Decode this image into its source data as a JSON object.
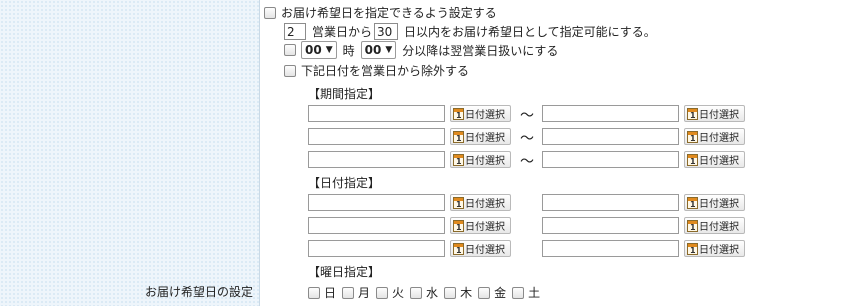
{
  "label": "お届け希望日の設定",
  "enable": {
    "label": "お届け希望日を指定できるよう設定する"
  },
  "range": {
    "from": "2",
    "to": "30",
    "text1": "営業日から",
    "text2": "日以内をお届け希望日として指定可能にする。"
  },
  "cutoff": {
    "hour": "00",
    "hour_unit": "時",
    "minute": "00",
    "suffix": "分以降は翌営業日扱いにする"
  },
  "exclude": {
    "label": "下記日付を営業日から除外する"
  },
  "period": {
    "title": "【期間指定】",
    "tilde": "～"
  },
  "dates": {
    "title": "【日付指定】"
  },
  "weekday": {
    "title": "【曜日指定】",
    "days": [
      "日",
      "月",
      "火",
      "水",
      "木",
      "金",
      "土"
    ]
  },
  "date_button": {
    "label": "日付選択",
    "icon_digit": "1"
  },
  "icons": {
    "calendar": "calendar-icon",
    "checkbox": "checkbox"
  }
}
